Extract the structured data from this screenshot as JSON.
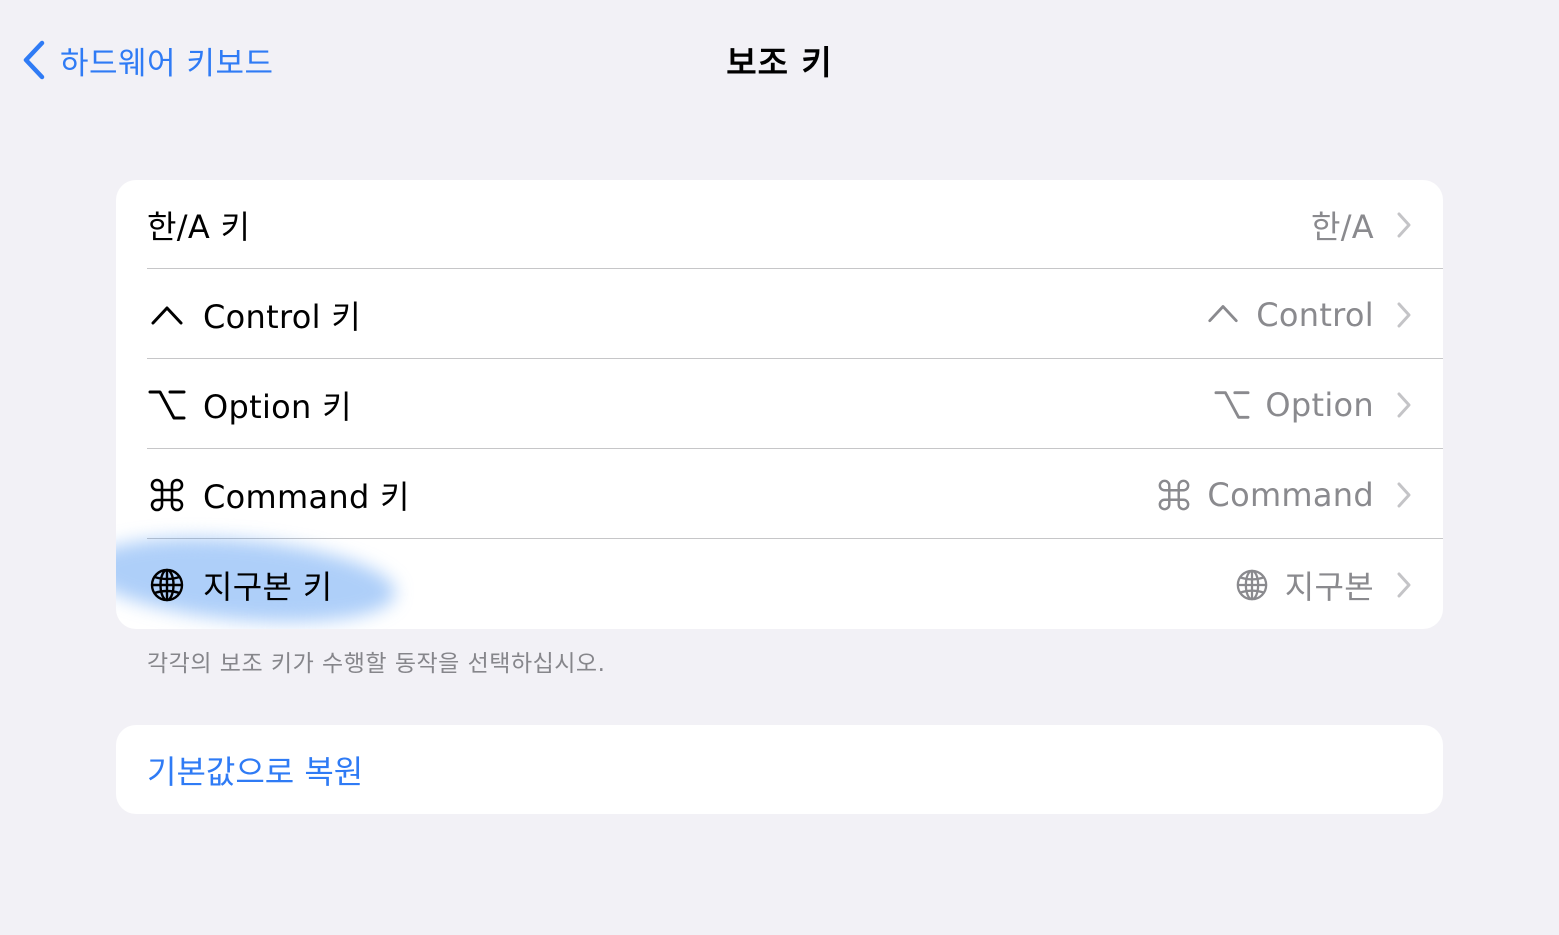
{
  "nav": {
    "back_label": "하드웨어 키보드",
    "title": "보조 키"
  },
  "rows": [
    {
      "label": "한/A 키",
      "value": "한/A",
      "icon": "none"
    },
    {
      "label": "Control 키",
      "value": "Control",
      "icon": "control-caret-icon"
    },
    {
      "label": "Option 키",
      "value": "Option",
      "icon": "option-key-icon"
    },
    {
      "label": "Command 키",
      "value": "Command",
      "icon": "command-key-icon"
    },
    {
      "label": "지구본 키",
      "value": "지구본",
      "icon": "globe-icon"
    }
  ],
  "footer": "각각의 보조 키가 수행할 동작을 선택하십시오.",
  "reset_label": "기본값으로 복원",
  "colors": {
    "accent": "#2f7bf5",
    "background": "#f2f1f6",
    "secondary_text": "#8a8a8e",
    "highlight": "#3f8cf0"
  }
}
